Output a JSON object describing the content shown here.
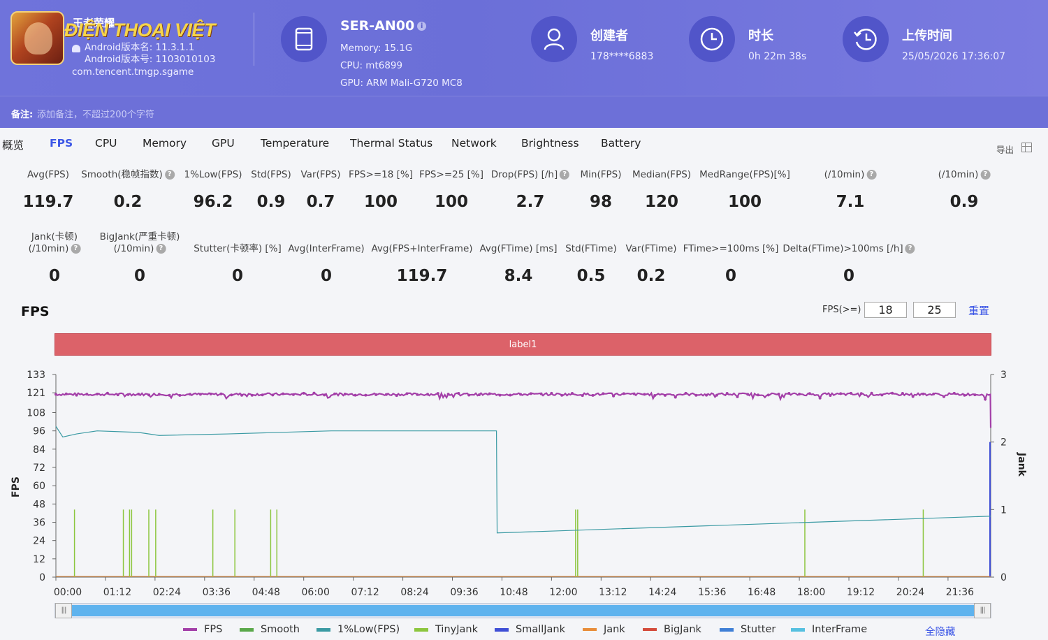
{
  "app": {
    "logo_cn": "王者荣耀",
    "logo_text": "ĐIỆN THOẠI VIỆT",
    "version_name": "Android版本名: 11.3.1.1",
    "version_code": "Android版本号: 1103010103",
    "package": "com.tencent.tmgp.sgame"
  },
  "device": {
    "name": "SER-AN00",
    "info_icon": "i",
    "memory": "Memory: 15.1G",
    "cpu": "CPU: mt6899",
    "gpu": "GPU: ARM Mali-G720 MC8"
  },
  "meta": {
    "creator_label": "创建者",
    "creator_value": "178****6883",
    "duration_label": "时长",
    "duration_value": "0h 22m 38s",
    "upload_label": "上传时间",
    "upload_value": "25/05/2026 17:36:07"
  },
  "note": {
    "label": "备注:",
    "placeholder": "添加备注，不超过200个字符"
  },
  "tabs": [
    "概览",
    "FPS",
    "CPU",
    "Memory",
    "GPU",
    "Temperature",
    "Thermal Status",
    "Network",
    "Brightness",
    "Battery"
  ],
  "active_tab": "FPS",
  "export_label": "导出",
  "help_glyph": "?",
  "stats_row1": [
    {
      "label": "Avg(FPS)",
      "value": "119.7",
      "help": false
    },
    {
      "label": "Smooth(稳帧指数)",
      "value": "0.2",
      "help": true
    },
    {
      "label": "1%Low(FPS)",
      "value": "96.2",
      "help": false
    },
    {
      "label": "Std(FPS)",
      "value": "0.9",
      "help": false
    },
    {
      "label": "Var(FPS)",
      "value": "0.7",
      "help": false
    },
    {
      "label": "FPS>=18 [%]",
      "value": "100",
      "help": false
    },
    {
      "label": "FPS>=25 [%]",
      "value": "100",
      "help": false
    },
    {
      "label": "Drop(FPS) [/h]",
      "value": "2.7",
      "help": true
    },
    {
      "label": "Min(FPS)",
      "value": "98",
      "help": false
    },
    {
      "label": "Median(FPS)",
      "value": "120",
      "help": false
    },
    {
      "label": "MedRange(FPS)[%]",
      "value": "100",
      "help": false
    },
    {
      "label": "(/10min)",
      "value": "7.1",
      "help": true
    },
    {
      "label": "(/10min)",
      "value": "0.9",
      "help": true
    }
  ],
  "stats_row2": [
    {
      "label": "Jank(卡顿)",
      "label2": "(/10min)",
      "value": "0",
      "help": true
    },
    {
      "label": "BigJank(严重卡顿)",
      "label2": "(/10min)",
      "value": "0",
      "help": true
    },
    {
      "label": "Stutter(卡顿率) [%]",
      "label2": "",
      "value": "0",
      "help": false
    },
    {
      "label": "Avg(InterFrame)",
      "label2": "",
      "value": "0",
      "help": false
    },
    {
      "label": "Avg(FPS+InterFrame)",
      "label2": "",
      "value": "119.7",
      "help": false
    },
    {
      "label": "Avg(FTime) [ms]",
      "label2": "",
      "value": "8.4",
      "help": false
    },
    {
      "label": "Std(FTime)",
      "label2": "",
      "value": "0.5",
      "help": false
    },
    {
      "label": "Var(FTime)",
      "label2": "",
      "value": "0.2",
      "help": false
    },
    {
      "label": "FTime>=100ms [%]",
      "label2": "",
      "value": "0",
      "help": false
    },
    {
      "label": "Delta(FTime)>100ms [/h]",
      "label2": "",
      "value": "0",
      "help": true
    }
  ],
  "fps_section": {
    "title": "FPS",
    "threshold_label": "FPS(>=)",
    "threshold1": "18",
    "threshold2": "25",
    "reset_label": "重置",
    "label_bar": "label1"
  },
  "chart_data": {
    "type": "line",
    "y_left_label": "FPS",
    "y_right_label": "Jank",
    "y_left_ticks": [
      0,
      12,
      24,
      36,
      48,
      60,
      72,
      84,
      96,
      108,
      121,
      133
    ],
    "y_right_ticks": [
      0,
      1,
      2,
      3
    ],
    "x_ticks": [
      "00:00",
      "01:12",
      "02:24",
      "03:36",
      "04:48",
      "06:00",
      "07:12",
      "08:24",
      "09:36",
      "10:48",
      "12:00",
      "13:12",
      "14:24",
      "15:36",
      "16:48",
      "18:00",
      "19:12",
      "20:24",
      "21:36"
    ],
    "x_range_sec": [
      0,
      1358
    ],
    "series": [
      {
        "name": "FPS",
        "color": "#a33fa8",
        "approx_value": 120,
        "min": 98
      },
      {
        "name": "1%Low(FPS)",
        "color": "#3a9aa3",
        "points": [
          [
            0,
            99
          ],
          [
            10,
            92
          ],
          [
            30,
            94
          ],
          [
            60,
            96
          ],
          [
            120,
            95
          ],
          [
            150,
            93
          ],
          [
            250,
            94
          ],
          [
            400,
            96
          ],
          [
            640,
            96
          ],
          [
            641,
            29
          ],
          [
            1358,
            40
          ]
        ]
      },
      {
        "name": "TinyJank",
        "color": "#8cc63e",
        "spikes_sec": [
          27,
          98,
          107,
          110,
          135,
          145,
          228,
          260,
          312,
          321,
          755,
          758,
          1088,
          1260
        ]
      },
      {
        "name": "SmallJank",
        "color": "#3f4fd6",
        "spikes_sec": [
          1358
        ]
      }
    ],
    "legend": [
      {
        "name": "FPS",
        "color": "#a33fa8",
        "marker": "dot"
      },
      {
        "name": "Smooth",
        "color": "#5aa84a",
        "marker": "line"
      },
      {
        "name": "1%Low(FPS)",
        "color": "#3a9aa3",
        "marker": "line"
      },
      {
        "name": "TinyJank",
        "color": "#8cc63e",
        "marker": "line"
      },
      {
        "name": "SmallJank",
        "color": "#3f4fd6",
        "marker": "line"
      },
      {
        "name": "Jank",
        "color": "#e88d3a",
        "marker": "dot"
      },
      {
        "name": "BigJank",
        "color": "#d44b3b",
        "marker": "dot"
      },
      {
        "name": "Stutter",
        "color": "#3f7fd6",
        "marker": "line"
      },
      {
        "name": "InterFrame",
        "color": "#56c0e0",
        "marker": "line"
      }
    ],
    "hide_all_label": "全隐藏"
  }
}
